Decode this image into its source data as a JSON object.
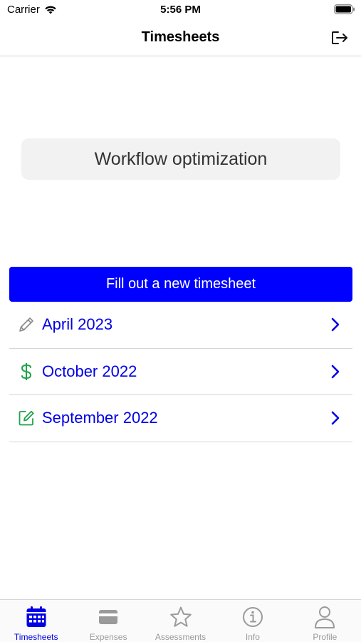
{
  "status_bar": {
    "carrier": "Carrier",
    "time": "5:56 PM"
  },
  "nav": {
    "title": "Timesheets",
    "logout_icon": "logout-icon"
  },
  "project": {
    "name": "Workflow optimization"
  },
  "primary_action": {
    "label": "Fill out a new timesheet",
    "color": "#0000ff"
  },
  "timesheets": [
    {
      "label": "April 2023",
      "icon": "pencil-icon",
      "icon_color": "#8a8a8a"
    },
    {
      "label": "October 2022",
      "icon": "dollar-icon",
      "icon_color": "#1fa34a"
    },
    {
      "label": "September 2022",
      "icon": "edit-square-icon",
      "icon_color": "#1fa34a"
    }
  ],
  "tabs": [
    {
      "label": "Timesheets",
      "icon": "calendar-icon",
      "active": true
    },
    {
      "label": "Expenses",
      "icon": "card-icon",
      "active": false
    },
    {
      "label": "Assessments",
      "icon": "star-icon",
      "active": false
    },
    {
      "label": "Info",
      "icon": "info-icon",
      "active": false
    },
    {
      "label": "Profile",
      "icon": "person-icon",
      "active": false
    }
  ],
  "colors": {
    "accent": "#0000e6",
    "success": "#1fa34a",
    "inactive": "#9a9a9a"
  }
}
